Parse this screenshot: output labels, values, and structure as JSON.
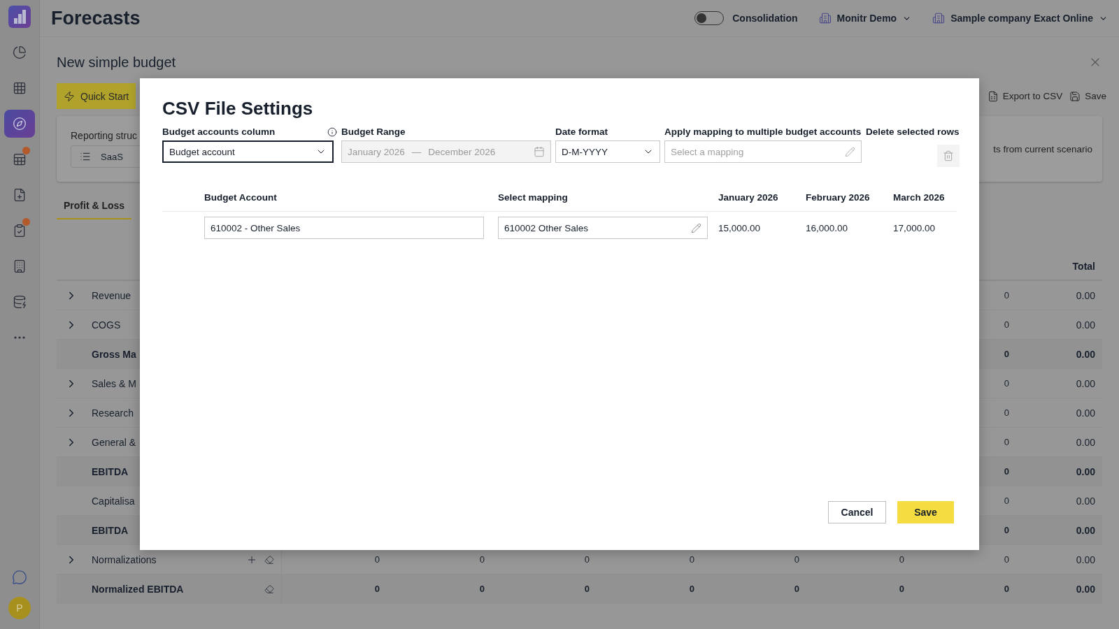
{
  "header": {
    "title": "Forecasts",
    "consolidation": {
      "label": "Consolidation",
      "on": false
    },
    "workspace": "Monitr Demo",
    "company": "Sample company Exact Online"
  },
  "sidebar": {
    "items": [
      {
        "kind": "reports",
        "selected": false,
        "alert": false
      },
      {
        "kind": "grid",
        "selected": false,
        "alert": false
      },
      {
        "kind": "forecast",
        "selected": true,
        "alert": false
      },
      {
        "kind": "sheet",
        "selected": false,
        "alert": true
      },
      {
        "kind": "add-doc",
        "selected": false,
        "alert": false
      },
      {
        "kind": "checklist",
        "selected": false,
        "alert": true
      },
      {
        "kind": "building",
        "selected": false,
        "alert": false
      },
      {
        "kind": "database",
        "selected": false,
        "alert": false
      },
      {
        "kind": "more",
        "selected": false,
        "alert": false
      }
    ],
    "assistant": true,
    "avatar": "P"
  },
  "page": {
    "title": "New simple budget",
    "quick_start": "Quick Start",
    "actions": [
      {
        "kind": "export",
        "label": "Export to CSV"
      },
      {
        "kind": "save",
        "label": "Save"
      }
    ],
    "reporting": {
      "label": "Reporting struc",
      "value": "SaaS",
      "note": "ts from current scenario"
    },
    "tabs": [
      {
        "label": "Profit & Loss",
        "selected": true
      }
    ],
    "table": {
      "total_header": "Total",
      "rows": [
        {
          "label": "Revenue",
          "bold": false,
          "expandable": true,
          "can_add": false,
          "can_clear": false,
          "cells": [
            "0",
            "0.00"
          ]
        },
        {
          "label": "COGS",
          "bold": false,
          "expandable": true,
          "can_add": false,
          "can_clear": false,
          "cells": [
            "0",
            "0.00"
          ]
        },
        {
          "label": "Gross Ma",
          "bold": true,
          "expandable": false,
          "can_add": false,
          "can_clear": false,
          "cells": [
            "0",
            "0.00"
          ]
        },
        {
          "label": "Sales & M",
          "bold": false,
          "expandable": true,
          "can_add": false,
          "can_clear": false,
          "cells": [
            "0",
            "0.00"
          ]
        },
        {
          "label": "Research",
          "bold": false,
          "expandable": true,
          "can_add": false,
          "can_clear": false,
          "cells": [
            "0",
            "0.00"
          ]
        },
        {
          "label": "General &",
          "bold": false,
          "expandable": true,
          "can_add": false,
          "can_clear": false,
          "cells": [
            "0",
            "0.00"
          ]
        },
        {
          "label": "EBITDA",
          "bold": true,
          "expandable": false,
          "can_add": false,
          "can_clear": false,
          "cells": [
            "0",
            "0.00"
          ]
        },
        {
          "label": "Capitalisa",
          "bold": false,
          "expandable": false,
          "can_add": false,
          "can_clear": false,
          "cells": [
            "0",
            "0.00"
          ]
        },
        {
          "label": "EBITDA",
          "bold": true,
          "expandable": false,
          "can_add": false,
          "can_clear": false,
          "cells": [
            "0",
            "0.00"
          ]
        },
        {
          "label": "Normalizations",
          "bold": false,
          "expandable": true,
          "can_add": true,
          "can_clear": true,
          "cells": [
            "0",
            "0",
            "0",
            "0",
            "0",
            "0",
            "0",
            "0.00"
          ]
        },
        {
          "label": "Normalized EBITDA",
          "bold": true,
          "expandable": false,
          "can_add": false,
          "can_clear": true,
          "cells": [
            "0",
            "0",
            "0",
            "0",
            "0",
            "0",
            "0",
            "0.00"
          ]
        }
      ]
    }
  },
  "modal": {
    "title": "CSV File Settings",
    "accounts_column": {
      "label": "Budget accounts column",
      "value": "Budget account"
    },
    "budget_range": {
      "label": "Budget Range",
      "start": "January 2026",
      "separator": "—",
      "end": "December 2026",
      "disabled": true
    },
    "date_format": {
      "label": "Date format",
      "value": "D-M-YYYY"
    },
    "apply_mapping": {
      "label": "Apply mapping to multiple budget accounts",
      "placeholder": "Select a mapping"
    },
    "delete_rows": {
      "label": "Delete selected rows"
    },
    "table": {
      "columns": [
        "Budget Account",
        "Select mapping",
        "January 2026",
        "February 2026",
        "March 2026"
      ],
      "rows": [
        {
          "account": "610002 - Other Sales",
          "mapping": "610002 Other Sales",
          "values": [
            "15,000.00",
            "16,000.00",
            "17,000.00"
          ]
        }
      ]
    },
    "cancel": "Cancel",
    "save": "Save"
  }
}
